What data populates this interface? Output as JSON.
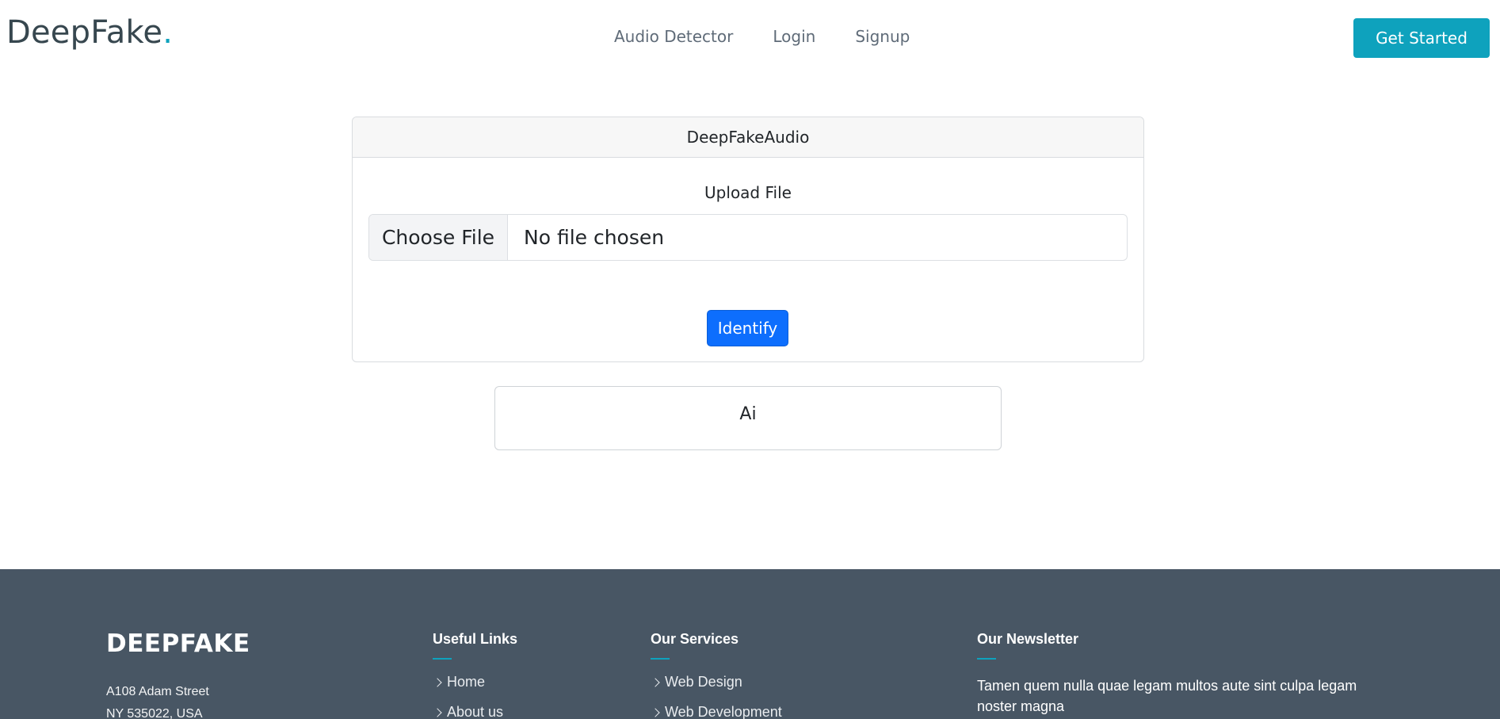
{
  "header": {
    "logo_text": "DeepFake",
    "logo_dot": ".",
    "nav": [
      "Audio Detector",
      "Login",
      "Signup"
    ],
    "cta_label": "Get Started"
  },
  "card": {
    "title": "DeepFakeAudio",
    "upload_label": "Upload File",
    "choose_file_label": "Choose File",
    "file_status": "No file chosen",
    "identify_label": "Identify"
  },
  "result": {
    "text": "Ai"
  },
  "footer": {
    "brand": "DEEPFAKE",
    "address_line1": "A108 Adam Street",
    "address_line2": "NY 535022, USA",
    "useful_links": {
      "title": "Useful Links",
      "items": [
        "Home",
        "About us"
      ]
    },
    "services": {
      "title": "Our Services",
      "items": [
        "Web Design",
        "Web Development"
      ]
    },
    "newsletter": {
      "title": "Our Newsletter",
      "text": "Tamen quem nulla quae legam multos aute sint culpa legam noster magna"
    }
  },
  "colors": {
    "accent": "#0ea2bd",
    "primary_button": "#0d6efd",
    "footer_bg": "#485664"
  }
}
